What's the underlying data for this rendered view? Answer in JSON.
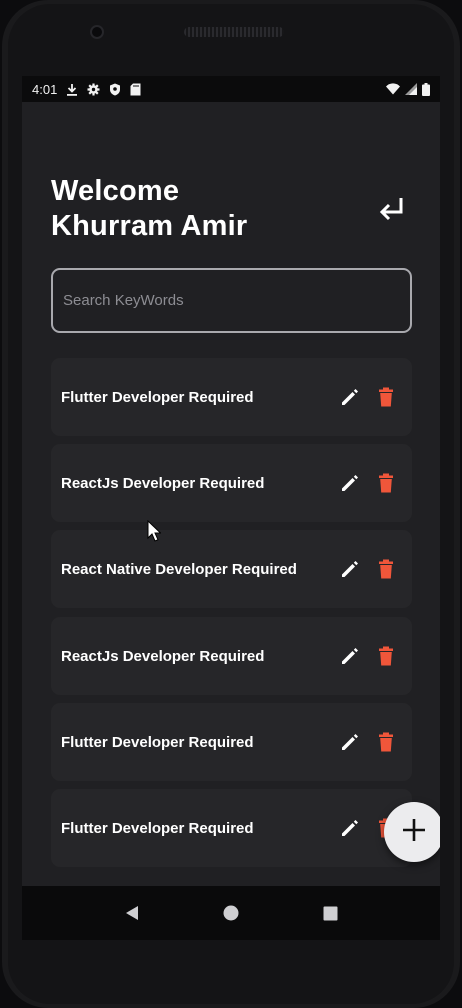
{
  "status_bar": {
    "time": "4:01",
    "left_icons": [
      "download-icon",
      "gear-icon",
      "shield-icon",
      "sd-card-icon"
    ],
    "right_icons": [
      "wifi-icon",
      "signal-icon",
      "battery-icon"
    ]
  },
  "header": {
    "welcome_line": "Welcome",
    "user_name": "Khurram Amir",
    "logout_icon": "logout-return-icon"
  },
  "search": {
    "placeholder": "Search KeyWords",
    "value": ""
  },
  "jobs": [
    {
      "title": "Flutter Developer Required"
    },
    {
      "title": "ReactJs Developer Required"
    },
    {
      "title": "React Native Developer Required"
    },
    {
      "title": "ReactJs Developer Required"
    },
    {
      "title": "Flutter Developer Required"
    },
    {
      "title": "Flutter Developer Required"
    }
  ],
  "colors": {
    "background": "#202023",
    "card": "#262629",
    "delete": "#f0563a",
    "text": "#ffffff",
    "fab": "#ececee"
  },
  "fab": {
    "icon": "plus-icon"
  },
  "nav": {
    "icons": [
      "back-triangle-icon",
      "home-circle-icon",
      "recents-square-icon"
    ]
  }
}
